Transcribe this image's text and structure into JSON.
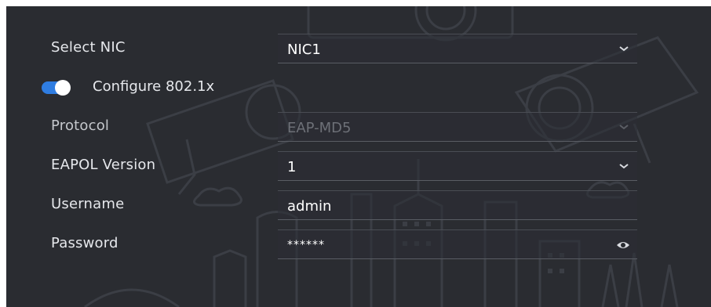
{
  "form": {
    "select_nic": {
      "label": "Select NIC",
      "value": "NIC1"
    },
    "configure_8021x": {
      "label": "Configure 802.1x",
      "enabled": true
    },
    "protocol": {
      "label": "Protocol",
      "value": "EAP-MD5",
      "disabled": true
    },
    "eapol_version": {
      "label": "EAPOL Version",
      "value": "1"
    },
    "username": {
      "label": "Username",
      "value": "admin"
    },
    "password": {
      "label": "Password",
      "value": "******"
    }
  },
  "colors": {
    "panel_bg": "#2a2c31",
    "toggle_on": "#2f7de1",
    "text": "#e6e8ec",
    "disabled_text": "#6d7077"
  },
  "icons": [
    "chevron-down-icon",
    "eye-icon"
  ]
}
